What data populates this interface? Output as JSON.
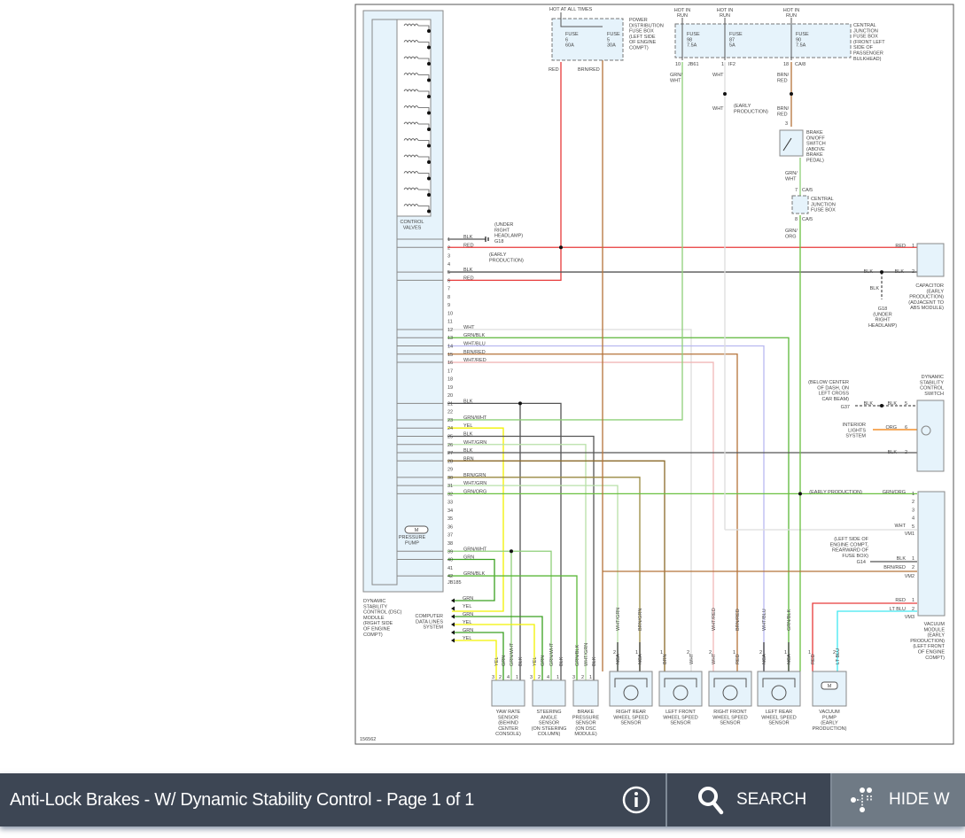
{
  "toolbar": {
    "title": "Anti-Lock Brakes - W/ Dynamic Stability Control - Page 1 of 1",
    "info_icon": "info-icon",
    "search_label": "SEARCH",
    "search_icon": "search-icon",
    "hide_label": "HIDE W",
    "hide_icon": "wiring-toggle-icon"
  },
  "colors": {
    "RED": "#e83a3a",
    "BLK": "#555555",
    "WHT": "#dddddd",
    "GRN/BLK": "#5cb83a",
    "WHT/BLU": "#b8b8f0",
    "BRN/RED": "#b5733a",
    "WHT/RED": "#f0b8b8",
    "GRN/WHT": "#8fd07a",
    "YEL": "#f2f200",
    "WHT/GRN": "#b8e0a8",
    "BRN": "#8a6a2a",
    "BRN/GRN": "#9a8a40",
    "GRN/ORG": "#6ac040",
    "GRN": "#3aa020",
    "ORG": "#f07a00",
    "LT BLU": "#40e8f0",
    "module_fill": "#e6f3fb"
  },
  "diagram": {
    "figure_id": "156562",
    "power": {
      "hot_at_all_times": "HOT AT ALL TIMES",
      "pdb_label": [
        "POWER",
        "DISTRIBUTION",
        "FUSE BOX",
        "(LEFT SIDE",
        "OF ENGINE",
        "COMPT)"
      ],
      "fuse6": [
        "FUSE",
        "6",
        "60A"
      ],
      "fuse5": [
        "FUSE",
        "5",
        "30A"
      ],
      "hot_in_run": "HOT IN RUN",
      "run": "RUN",
      "fuse98": [
        "FUSE",
        "98",
        "7.5A"
      ],
      "fuse87": [
        "FUSE",
        "87",
        "5A"
      ],
      "fuse90": [
        "FUSE",
        "90",
        "7.5A"
      ],
      "cjb_label": [
        "CENTRAL",
        "JUNCTION",
        "FUSE BOX",
        "(FRONT LEFT",
        "SIDE OF",
        "PASSENGER",
        "BULKHEAD)"
      ],
      "conn_jb61": "JB61",
      "pin_10": "10",
      "conn_if2": "IF2",
      "pin_1": "1",
      "conn_ca8": "CA/8",
      "pin_18": "18",
      "wire_red": "RED",
      "wire_brnred": "BRN/RED",
      "wire_grnwht": [
        "GRN/",
        "WHT"
      ],
      "wire_wht": "WHT",
      "wire_brn_red": [
        "BRN/",
        "RED"
      ],
      "early_production": [
        "(EARLY",
        "PRODUCTION)"
      ],
      "brake_switch": [
        "BRAKE",
        "ON/OFF",
        "SWITCH",
        "(ABOVE",
        "BRAKE",
        "PEDAL)"
      ],
      "pin_3": "3",
      "cjb2_label": [
        "CENTRAL",
        "JUNCTION",
        "FUSE BOX"
      ],
      "conn_ca5": "CA/5",
      "pin_7": "7",
      "pin_8": "8",
      "wire_grnorg": [
        "GRN/",
        "ORG"
      ]
    },
    "module": {
      "control_valves": [
        "CONTROL",
        "VALVES"
      ],
      "pressure_pump": [
        "PRESSURE",
        "PUMP"
      ],
      "motor": "M",
      "connector": "JB185",
      "label": [
        "DYNAMIC",
        "STABILITY",
        "CONTROL (DSC)",
        "MODULE",
        "(RIGHT SIDE",
        "OF ENGINE",
        "COMPT)"
      ]
    },
    "pins": [
      {
        "n": "1",
        "wire": "BLK"
      },
      {
        "n": "2",
        "wire": "RED"
      },
      {
        "n": "3",
        "wire": ""
      },
      {
        "n": "4",
        "wire": ""
      },
      {
        "n": "5",
        "wire": "BLK"
      },
      {
        "n": "6",
        "wire": "RED"
      },
      {
        "n": "7",
        "wire": ""
      },
      {
        "n": "8",
        "wire": ""
      },
      {
        "n": "9",
        "wire": ""
      },
      {
        "n": "10",
        "wire": ""
      },
      {
        "n": "11",
        "wire": ""
      },
      {
        "n": "12",
        "wire": "WHT"
      },
      {
        "n": "13",
        "wire": "GRN/BLK"
      },
      {
        "n": "14",
        "wire": "WHT/BLU"
      },
      {
        "n": "15",
        "wire": "BRN/RED"
      },
      {
        "n": "16",
        "wire": "WHT/RED"
      },
      {
        "n": "17",
        "wire": ""
      },
      {
        "n": "18",
        "wire": ""
      },
      {
        "n": "19",
        "wire": ""
      },
      {
        "n": "20",
        "wire": ""
      },
      {
        "n": "21",
        "wire": "BLK"
      },
      {
        "n": "22",
        "wire": ""
      },
      {
        "n": "23",
        "wire": "GRN/WHT"
      },
      {
        "n": "24",
        "wire": "YEL"
      },
      {
        "n": "25",
        "wire": "BLK"
      },
      {
        "n": "26",
        "wire": "WHT/GRN"
      },
      {
        "n": "27",
        "wire": "BLK"
      },
      {
        "n": "28",
        "wire": "BRN"
      },
      {
        "n": "29",
        "wire": ""
      },
      {
        "n": "30",
        "wire": "BRN/GRN"
      },
      {
        "n": "31",
        "wire": "WHT/GRN"
      },
      {
        "n": "32",
        "wire": "GRN/ORG"
      },
      {
        "n": "33",
        "wire": ""
      },
      {
        "n": "34",
        "wire": ""
      },
      {
        "n": "35",
        "wire": ""
      },
      {
        "n": "36",
        "wire": ""
      },
      {
        "n": "37",
        "wire": ""
      },
      {
        "n": "38",
        "wire": ""
      },
      {
        "n": "39",
        "wire": "GRN/WHT"
      },
      {
        "n": "40",
        "wire": "GRN"
      },
      {
        "n": "41",
        "wire": ""
      },
      {
        "n": "42",
        "wire": "GRN/BLK"
      }
    ],
    "ground_g18": [
      "(UNDER",
      "RIGHT",
      "HEADLAMP)",
      "G18"
    ],
    "capacitor": {
      "label": [
        "CAPACITOR",
        "(EARLY",
        "PRODUCTION)",
        "(ADJACENT TO",
        "ABS MODULE)"
      ],
      "p1": "1",
      "p2": "2",
      "w1": "RED",
      "w2": "BLK",
      "w3": "BLK",
      "w4": "BLK",
      "g18": [
        "G18",
        "(UNDER",
        "RIGHT",
        "HEADLAMP)"
      ]
    },
    "dsc_switch": {
      "label": [
        "DYNAMIC",
        "STABILITY",
        "CONTROL",
        "SWITCH"
      ],
      "g37_loc": [
        "(BELOW CENTER",
        "OF DASH, ON",
        "LEFT CROSS",
        "CAR BEAM)"
      ],
      "g37": "G37",
      "interior": [
        "INTERIOR",
        "LIGHTS",
        "SYSTEM"
      ],
      "p5": "5",
      "p6": "6",
      "p2": "2",
      "w5": "BLK",
      "w5b": "BLK",
      "w6": "ORG",
      "w2": "BLK"
    },
    "vacuum_module": {
      "label": [
        "VACUUM",
        "MODULE",
        "(EARLY",
        "PRODUCTION)",
        "(LEFT FRONT",
        "OF ENGINE",
        "COMPT)"
      ],
      "early": "(EARLY PRODUCTION)",
      "pins1": [
        "1",
        "2",
        "3",
        "4",
        "5"
      ],
      "w1": "GRN/ORG",
      "w5": "WHT",
      "vm1": "VM1",
      "g14_loc": [
        "(LEFT SIDE OF",
        "ENGINE COMPT,",
        "REARWARD OF",
        "FUSE BOX)"
      ],
      "g14": "G14",
      "pins2": [
        "1",
        "2"
      ],
      "w21": "BLK",
      "w22": "BRN/RED",
      "vm2": "VM2",
      "pins3": [
        "1",
        "2"
      ],
      "w31": "RED",
      "w32": "LT BLU",
      "vm3": "VM3"
    },
    "data_lines": {
      "label": [
        "COMPUTER",
        "DATA LINES",
        "SYSTEM"
      ],
      "wires": [
        "GRN",
        "YEL",
        "GRN",
        "YEL",
        "GRN",
        "YEL"
      ]
    },
    "sensors": [
      {
        "id": "yaw",
        "label": [
          "YAW RATE",
          "SENSOR",
          "(BEHIND",
          "CENTER",
          "CONSOLE)"
        ],
        "wires": [
          "YEL",
          "GRN",
          "GRN/WHT",
          "BLK"
        ],
        "pins": [
          "3",
          "2",
          "4",
          "1"
        ]
      },
      {
        "id": "steer",
        "label": [
          "STEERING",
          "ANGLE",
          "SENSOR",
          "(ON STEERING",
          "COLUMN)"
        ],
        "wires": [
          "YEL",
          "GRN",
          "GRN/WHT",
          "BLK"
        ],
        "pins": [
          "3",
          "2",
          "4",
          "1"
        ]
      },
      {
        "id": "brake",
        "label": [
          "BRAKE",
          "PRESSURE",
          "SENSOR",
          "(ON DSC",
          "MODULE)"
        ],
        "wires": [
          "GRN/BLK",
          "WHT/GRN",
          "BLK"
        ],
        "pins": [
          "3",
          "2",
          "1"
        ]
      },
      {
        "id": "rr",
        "label": [
          "RIGHT REAR",
          "WHEEL SPEED",
          "SENSOR"
        ],
        "wires": [
          "NCA",
          "NCA"
        ],
        "pins": [
          "2",
          "1"
        ],
        "harness": [
          "WHT/GRN",
          "BRN/GRN"
        ]
      },
      {
        "id": "lf",
        "label": [
          "LEFT FRONT",
          "WHEEL SPEED",
          "SENSOR"
        ],
        "wires": [
          "BRN",
          "WHT"
        ],
        "pins": [
          "1",
          "2"
        ],
        "harness": []
      },
      {
        "id": "rf",
        "label": [
          "RIGHT FRONT",
          "WHEEL SPEED",
          "SENSOR"
        ],
        "wires": [
          "WHT",
          "RED"
        ],
        "pins": [
          "2",
          "1"
        ],
        "harness": [
          "WHT/RED",
          "BRN/RED"
        ]
      },
      {
        "id": "lr",
        "label": [
          "LEFT REAR",
          "WHEEL SPEED",
          "SENSOR"
        ],
        "wires": [
          "NCA",
          "NCA"
        ],
        "pins": [
          "2",
          "1"
        ],
        "harness": [
          "WHT/BLU",
          "GRN/BLK"
        ]
      },
      {
        "id": "vp",
        "label": [
          "VACUUM",
          "PUMP",
          "(EARLY",
          "PRODUCTION)"
        ],
        "wires": [
          "RED",
          "LT BLU"
        ],
        "pins": [
          "1",
          "2"
        ],
        "harness": []
      }
    ]
  }
}
